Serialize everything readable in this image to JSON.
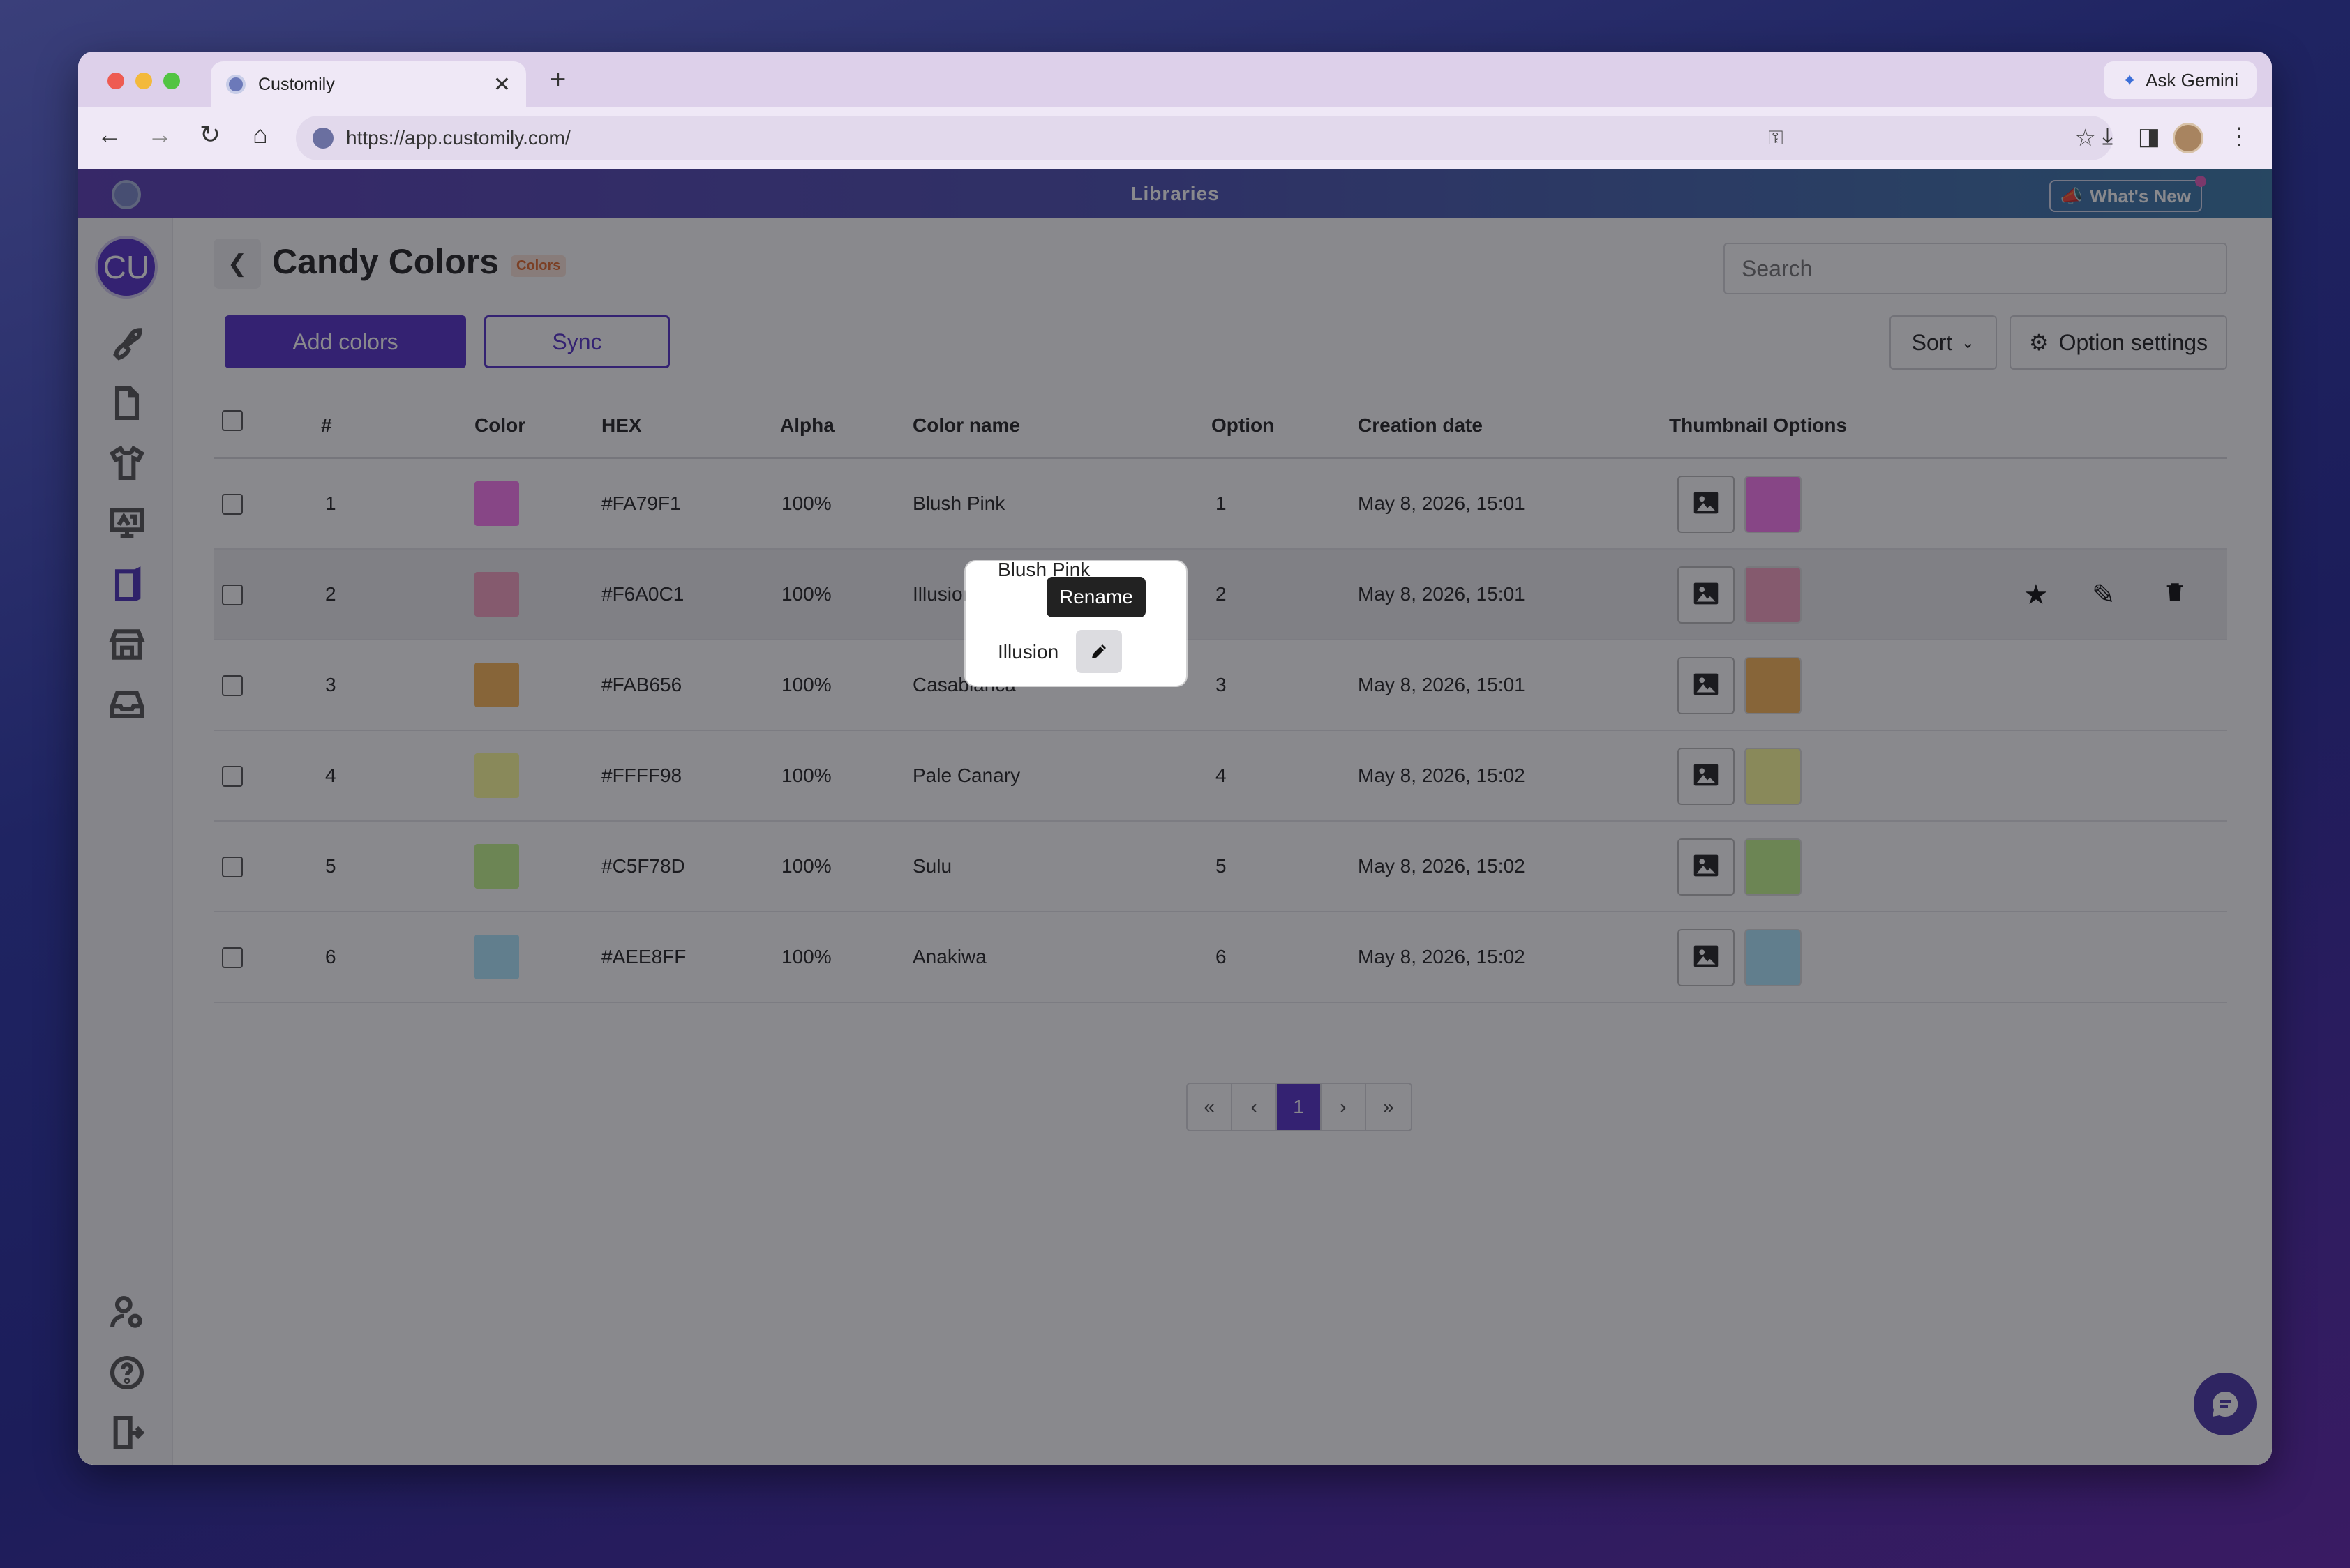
{
  "browser": {
    "tab_title": "Customily",
    "url": "https://app.customily.com/",
    "gemini_label": "Ask Gemini"
  },
  "app": {
    "section_title": "Libraries",
    "whats_new": "What's New",
    "user_initials": "CU"
  },
  "page": {
    "title": "Candy Colors",
    "type_badge": "Colors",
    "search_placeholder": "Search",
    "add_colors": "Add colors",
    "sync": "Sync",
    "sort": "Sort",
    "option_settings": "Option settings"
  },
  "table": {
    "headers": [
      "#",
      "Color",
      "HEX",
      "Alpha",
      "Color name",
      "Option",
      "Creation date",
      "Thumbnail Options"
    ],
    "rows": [
      {
        "num": "1",
        "hex": "#FA79F1",
        "color": "#fa79f1",
        "alpha": "100%",
        "name": "Blush Pink",
        "option": "1",
        "date": "May 8, 2026, 15:01"
      },
      {
        "num": "2",
        "hex": "#F6A0C1",
        "color": "#f6a0c1",
        "alpha": "100%",
        "name": "Illusion",
        "option": "2",
        "date": "May 8, 2026, 15:01"
      },
      {
        "num": "3",
        "hex": "#FAB656",
        "color": "#fab656",
        "alpha": "100%",
        "name": "Casablanca",
        "option": "3",
        "date": "May 8, 2026, 15:01"
      },
      {
        "num": "4",
        "hex": "#FFFF98",
        "color": "#ffff98",
        "alpha": "100%",
        "name": "Pale Canary",
        "option": "4",
        "date": "May 8, 2026, 15:02"
      },
      {
        "num": "5",
        "hex": "#C5F78D",
        "color": "#c5f78d",
        "alpha": "100%",
        "name": "Sulu",
        "option": "5",
        "date": "May 8, 2026, 15:02"
      },
      {
        "num": "6",
        "hex": "#AEE8FF",
        "color": "#aee8ff",
        "alpha": "100%",
        "name": "Anakiwa",
        "option": "6",
        "date": "May 8, 2026, 15:02"
      }
    ]
  },
  "pagination": {
    "first": "«",
    "prev": "‹",
    "current": "1",
    "next": "›",
    "last": "»"
  },
  "tooltip": {
    "rename": "Rename"
  },
  "colors": {
    "accent": "#5531c8",
    "badge_bg": "#fde4d8",
    "badge_text": "#e26a2c"
  }
}
